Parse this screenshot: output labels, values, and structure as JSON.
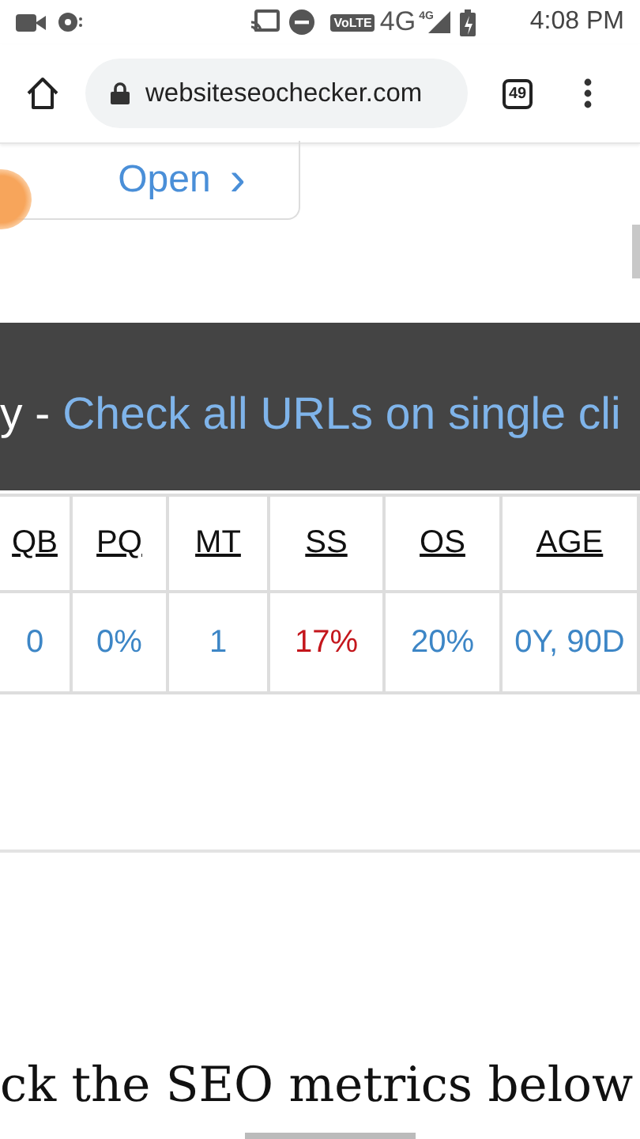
{
  "status_bar": {
    "time": "4:08 PM",
    "volte": "VoLTE",
    "network": "4G",
    "signal_network": "4G"
  },
  "browser": {
    "url": "websiteseochecker.com",
    "tab_count": "49"
  },
  "open_button": {
    "label": "Open",
    "arrow": "›"
  },
  "banner": {
    "lead": "y - ",
    "link": "Check all URLs on single cli"
  },
  "table": {
    "columns": [
      "QB",
      "PQ",
      "MT",
      "SS",
      "OS",
      "AGE"
    ],
    "rows": [
      [
        {
          "text": "0",
          "color": "#3d86c6"
        },
        {
          "text": "0%",
          "color": "#3d86c6"
        },
        {
          "text": "1",
          "color": "#3d86c6"
        },
        {
          "text": "17%",
          "color": "#c4161c"
        },
        {
          "text": "20%",
          "color": "#3d86c6"
        },
        {
          "text": "0Y, 90D",
          "color": "#3d86c6"
        }
      ]
    ]
  },
  "heading": "ck the SEO metrics below"
}
